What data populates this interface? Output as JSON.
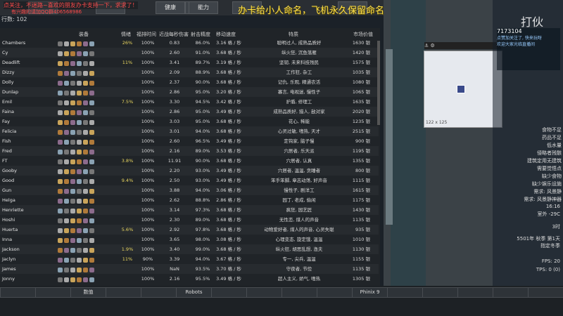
{
  "overlay": {
    "line1": "点关注，不迷路~喜欢的朋友办卡支持一下，求求了！",
    "line2": "有兴趣的请加QQ群406568986",
    "caption": "办卡给小人命名，飞机永久保留命名。"
  },
  "tabs": [
    "",
    "",
    "健康",
    "",
    "能力",
    "",
    ""
  ],
  "count_label": "行数: 102",
  "columns": [
    "装备",
    "情绪",
    "福排时间",
    "近战每秒伤害",
    "射击精度",
    "移动速度",
    "特质",
    "市场价值"
  ],
  "rows": [
    {
      "name": "Chambers",
      "mood": "26%",
      "pct": "100%",
      "dps": "0.83",
      "acc": "86.0%",
      "spd": "3.16 格 / 秒",
      "trait": "聪明过人, 成熟品质好",
      "val": "1630 银"
    },
    {
      "name": "Cy",
      "mood": "",
      "pct": "100%",
      "dps": "2.60",
      "acc": "91.0%",
      "spd": "3.68 格 / 秒",
      "trait": "纵火狂, 沉鱼落雁",
      "val": "1420 银"
    },
    {
      "name": "Deadlift",
      "mood": "11%",
      "pct": "100%",
      "dps": "3.41",
      "acc": "89.7%",
      "spd": "3.19 格 / 秒",
      "trait": "坚韧, 未来科技残民",
      "val": "1575 银"
    },
    {
      "name": "Dizzy",
      "mood": "",
      "pct": "100%",
      "dps": "2.09",
      "acc": "88.9%",
      "spd": "3.68 格 / 秒",
      "trait": "工作狂, 杂工",
      "val": "1035 银"
    },
    {
      "name": "Dolly",
      "mood": "",
      "pct": "100%",
      "dps": "2.37",
      "acc": "90.0%",
      "spd": "3.68 格 / 秒",
      "trait": "记仇, 乐观, 精通农活",
      "val": "1080 银"
    },
    {
      "name": "Dunlap",
      "mood": "",
      "pct": "100%",
      "dps": "2.86",
      "acc": "95.0%",
      "spd": "3.20 格 / 秒",
      "trait": "寡言, 电视迷, 慢性子",
      "val": "1065 银"
    },
    {
      "name": "Emil",
      "mood": "7.5%",
      "pct": "100%",
      "dps": "3.30",
      "acc": "94.5%",
      "spd": "3.42 格 / 秒",
      "trait": "护盾, 修理工",
      "val": "1635 银"
    },
    {
      "name": "Faina",
      "mood": "",
      "pct": "100%",
      "dps": "2.86",
      "acc": "95.0%",
      "spd": "3.49 格 / 秒",
      "trait": "成熟品质好, 猎人, 敌对家",
      "val": "2020 银"
    },
    {
      "name": "Fay",
      "mood": "",
      "pct": "100%",
      "dps": "3.03",
      "acc": "95.0%",
      "spd": "3.68 格 / 秒",
      "trait": "花心, 稀能",
      "val": "1235 银"
    },
    {
      "name": "Felicia",
      "mood": "",
      "pct": "100%",
      "dps": "3.01",
      "acc": "94.0%",
      "spd": "3.68 格 / 秒",
      "trait": "心灵过敏, 嗜热, 天才",
      "val": "2515 银"
    },
    {
      "name": "Fish",
      "mood": "",
      "pct": "100%",
      "dps": "2.60",
      "acc": "96.5%",
      "spd": "3.49 格 / 秒",
      "trait": "定钩家, 脑子慢",
      "val": "900 银"
    },
    {
      "name": "Fred",
      "mood": "",
      "pct": "100%",
      "dps": "2.16",
      "acc": "89.0%",
      "spd": "3.53 格 / 秒",
      "trait": "穴居者, 乐天派",
      "val": "1195 银"
    },
    {
      "name": "FT",
      "mood": "3.8%",
      "pct": "100%",
      "dps": "11.91",
      "acc": "90.0%",
      "spd": "3.68 格 / 秒",
      "trait": "穴居者, 认真",
      "val": "1355 银"
    },
    {
      "name": "Gooby",
      "mood": "",
      "pct": "100%",
      "dps": "2.20",
      "acc": "93.0%",
      "spd": "3.49 格 / 秒",
      "trait": "穴居者, 温温, 贪睡者",
      "val": "800 银"
    },
    {
      "name": "Good",
      "mood": "9.4%",
      "pct": "100%",
      "dps": "2.50",
      "acc": "93.0%",
      "spd": "3.49 格 / 秒",
      "trait": "笨手笨脚, 章志动荡, 好声音",
      "val": "1115 银"
    },
    {
      "name": "Gun",
      "mood": "",
      "pct": "100%",
      "dps": "3.88",
      "acc": "94.0%",
      "spd": "3.06 格 / 秒",
      "trait": "慢性子, 剧洋工",
      "val": "1615 银"
    },
    {
      "name": "Helga",
      "mood": "",
      "pct": "100%",
      "dps": "2.62",
      "acc": "88.8%",
      "spd": "2.86 格 / 秒",
      "trait": "园丁, 老成, 偷闲",
      "val": "1175 银"
    },
    {
      "name": "Henriette",
      "mood": "",
      "pct": "100%",
      "dps": "3.14",
      "acc": "97.3%",
      "spd": "3.68 格 / 秒",
      "trait": "疯狂, 园艺匠",
      "val": "1430 银"
    },
    {
      "name": "Hoshi",
      "mood": "",
      "pct": "100%",
      "dps": "2.30",
      "acc": "89.0%",
      "spd": "3.68 格 / 秒",
      "trait": "无性恋, 煤人的声音",
      "val": "1135 银"
    },
    {
      "name": "Huerta",
      "mood": "5.6%",
      "pct": "100%",
      "dps": "2.92",
      "acc": "97.8%",
      "spd": "3.68 格 / 秒",
      "trait": "动物爱好者, 煤人的声音, 心灵失聪",
      "val": "935 银"
    },
    {
      "name": "Inna",
      "mood": "",
      "pct": "100%",
      "dps": "3.65",
      "acc": "98.0%",
      "spd": "3.08 格 / 秒",
      "trait": "心理变态, 旋定饿, 温温",
      "val": "1010 银"
    },
    {
      "name": "Jackson",
      "mood": "1.9%",
      "pct": "100%",
      "dps": "3.40",
      "acc": "99.0%",
      "spd": "3.68 格 / 秒",
      "trait": "纵火狂, 胡思乱想, 渔夫",
      "val": "1130 银"
    },
    {
      "name": "Jaclyn",
      "mood": "11%",
      "pct": "90%",
      "dps": "3.39",
      "acc": "94.0%",
      "spd": "3.67 格 / 秒",
      "trait": "专一, 尖兵, 温温",
      "val": "1155 银"
    },
    {
      "name": "James",
      "mood": "",
      "pct": "100%",
      "dps": "NaN",
      "acc": "93.5%",
      "spd": "3.70 格 / 秒",
      "trait": "守夜者, 节俭",
      "val": "1135 银"
    },
    {
      "name": "Jonny",
      "mood": "",
      "pct": "100%",
      "dps": "2.16",
      "acc": "95.5%",
      "spd": "3.49 格 / 秒",
      "trait": "超人主义, 娇气, 嗜热",
      "val": "1305 银"
    }
  ],
  "right_alerts": [
    "食物不足",
    "药品不足",
    "低水量",
    "侵略者残骸",
    "建筑定用无建筑",
    "需要觉悟点",
    "缺少食物",
    "缺少娱乐设施",
    "需求: 风景静",
    "需求: 风景静神器"
  ],
  "status": {
    "time": "16:16",
    "temp": "室外 -29C",
    "day_label": "3时",
    "date": "5501年 秋季 第1天",
    "weather": "指定冬季",
    "fps": "FPS: 20",
    "tps": "TPS: 0 (0)",
    "zoom": "122 x 125"
  },
  "minimap_coord": "122 x 125",
  "bottom_buttons": [
    "",
    "",
    "数值",
    "",
    "",
    "Robots",
    "",
    "",
    "",
    "",
    "Phinix 9",
    "",
    "",
    "",
    "",
    ""
  ],
  "watermark": "打伙",
  "stream_panel": {
    "label": "7173104",
    "chat": [
      "点赞加关注了, 快来玩呀",
      "欢迎大家光临直播间"
    ]
  },
  "colors": {
    "accent": "#6de36d",
    "warn": "#e36d6d",
    "gold": "#e8d55f"
  }
}
